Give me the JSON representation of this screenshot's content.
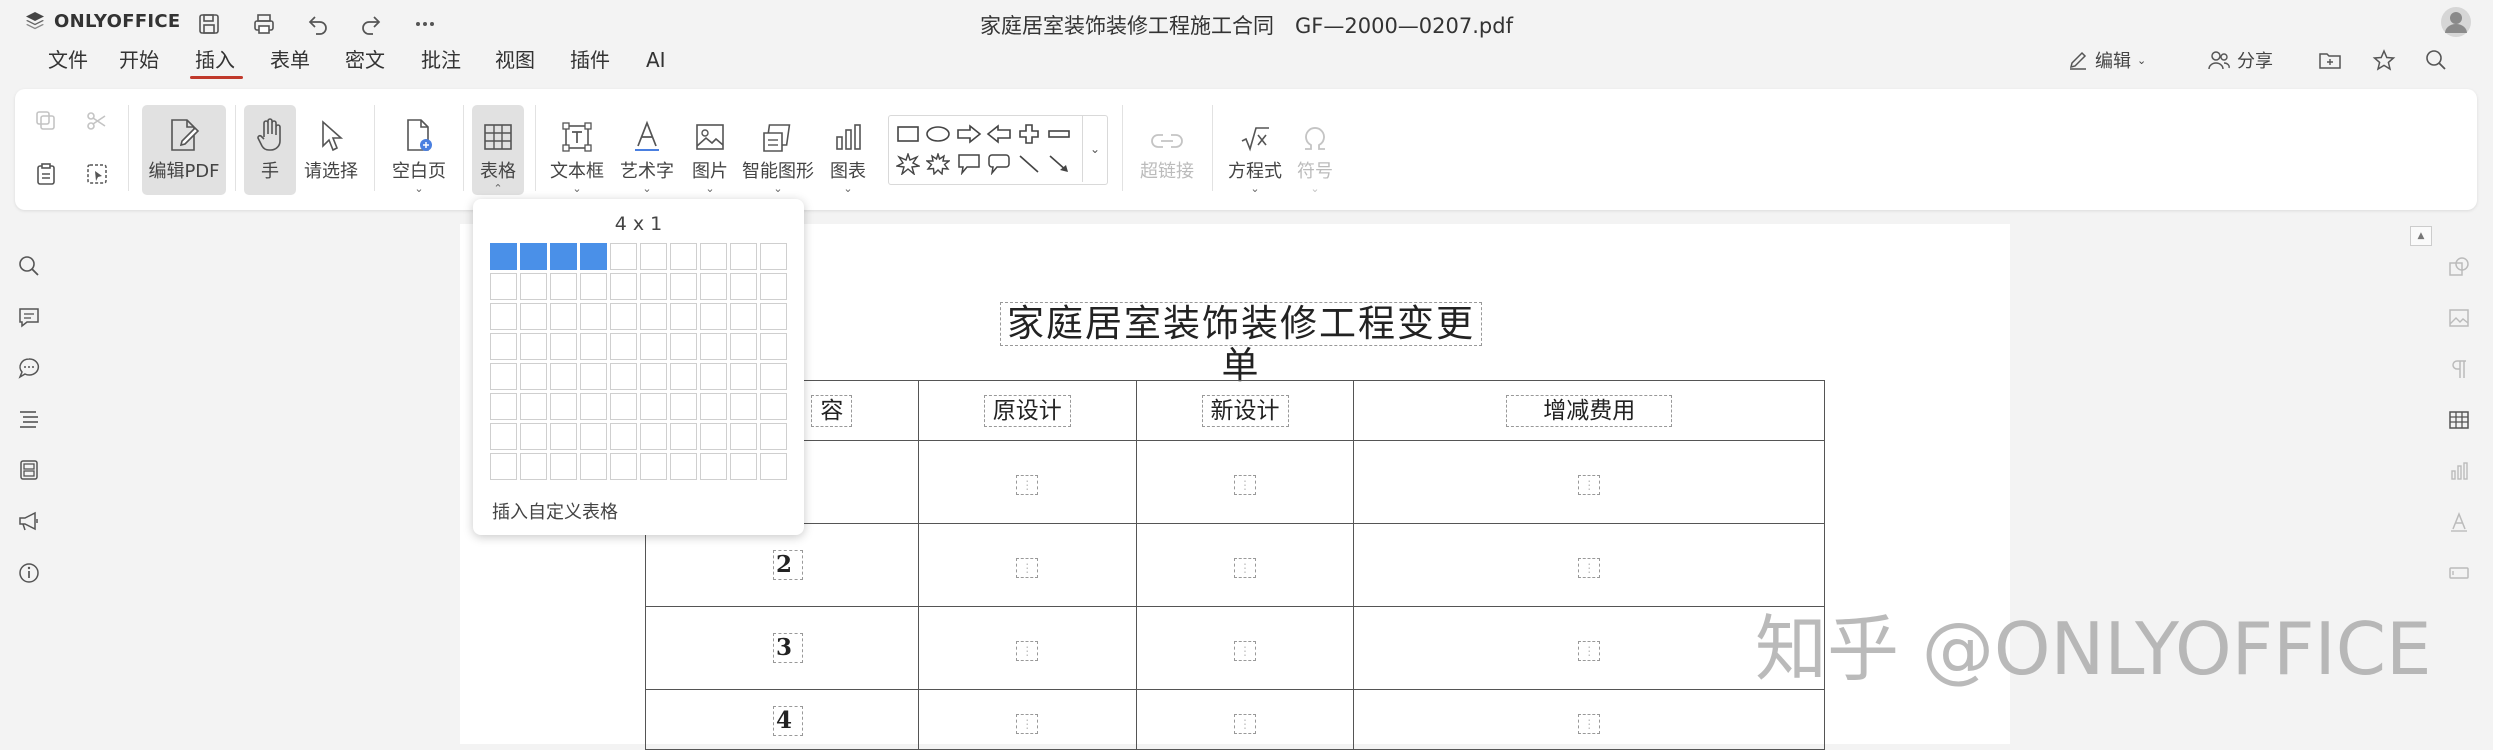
{
  "app": {
    "brand": "ONLYOFFICE",
    "doc_title": "家庭居室装饰装修工程施工合同　GF—2000—0207.pdf"
  },
  "quick_actions": {
    "save": "save-icon",
    "print": "print-icon",
    "undo": "undo-icon",
    "redo": "redo-icon",
    "more": "more-icon"
  },
  "menu": {
    "items": [
      "文件",
      "开始",
      "插入",
      "表单",
      "密文",
      "批注",
      "视图",
      "插件",
      "AI"
    ],
    "active": "插入"
  },
  "header_right": {
    "edit_label": "编辑",
    "share_label": "分享"
  },
  "toolbar": {
    "edit_pdf": "编辑PDF",
    "hand": "手",
    "select": "请选择",
    "blank_page": "空白页",
    "table": "表格",
    "textbox": "文本框",
    "art_text": "艺术字",
    "image": "图片",
    "smart_shape": "智能图形",
    "chart": "图表",
    "hyperlink": "超链接",
    "equation": "方程式",
    "symbol": "符号"
  },
  "table_popup": {
    "size_label": "4 x 1",
    "cols": 10,
    "rows": 8,
    "selected_cols": 4,
    "selected_rows": 1,
    "custom_label": "插入自定义表格"
  },
  "document": {
    "heading": "家庭居室装饰装修工程变更单",
    "header_cells": [
      "容",
      "原设计",
      "新设计",
      "增减费用"
    ],
    "row_numbers": [
      "",
      "2",
      "3",
      "4"
    ]
  },
  "watermark": "知乎 @ONLYOFFICE",
  "colors": {
    "accent": "#c0392b",
    "selection": "#4a90e8"
  }
}
